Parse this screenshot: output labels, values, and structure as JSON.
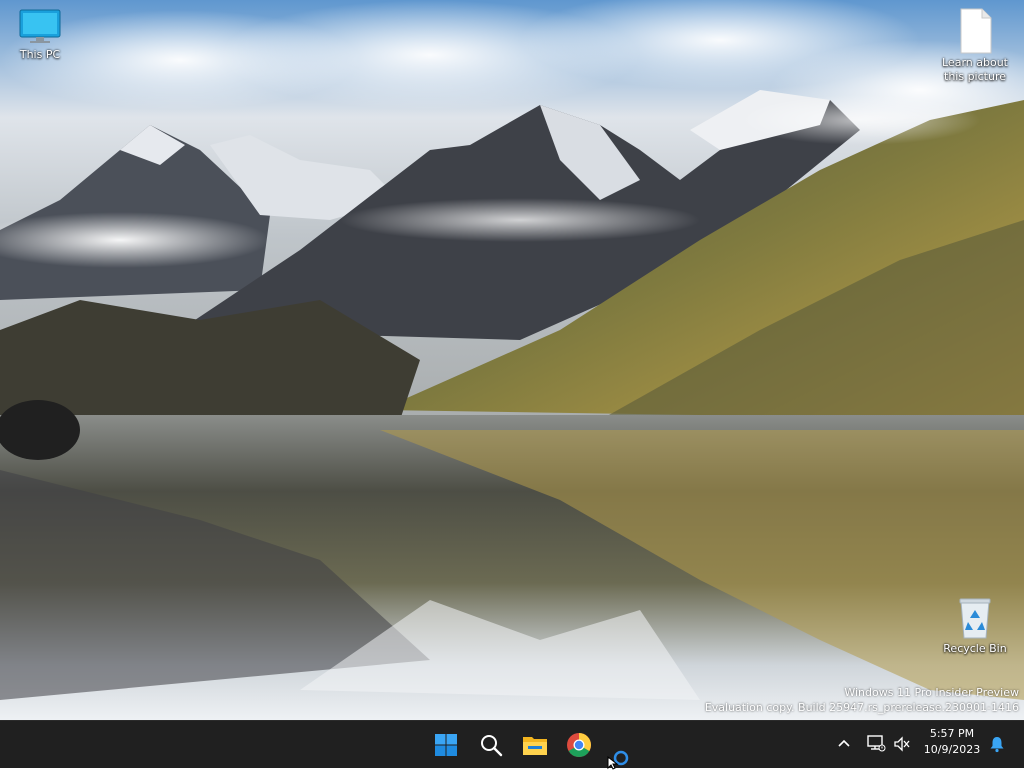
{
  "desktop": {
    "icons": [
      {
        "label": "This PC",
        "icon": "monitor-icon"
      },
      {
        "label": "Learn about this picture",
        "icon": "document-icon"
      },
      {
        "label": "Recycle Bin",
        "icon": "recycle-bin-icon"
      }
    ],
    "watermark": {
      "line1": "Windows 11 Pro Insider Preview",
      "line2": "Evaluation copy. Build 25947.rs_prerelease.230901-1416"
    }
  },
  "taskbar": {
    "background": "#202020",
    "apps": [
      {
        "icon": "windows-start-icon"
      },
      {
        "icon": "search-icon"
      },
      {
        "icon": "file-explorer-icon"
      },
      {
        "icon": "chrome-icon"
      }
    ],
    "tray": {
      "chevron_icon": "chevron-up-icon",
      "network_icon": "network-icon",
      "volume_icon": "volume-muted-icon",
      "bell_icon": "notification-bell-icon"
    },
    "clock": {
      "time": "5:57 PM",
      "date": "10/9/2023"
    }
  },
  "colors": {
    "accent": "#1e90ff",
    "taskbar": "#202020",
    "text": "#ffffff"
  }
}
